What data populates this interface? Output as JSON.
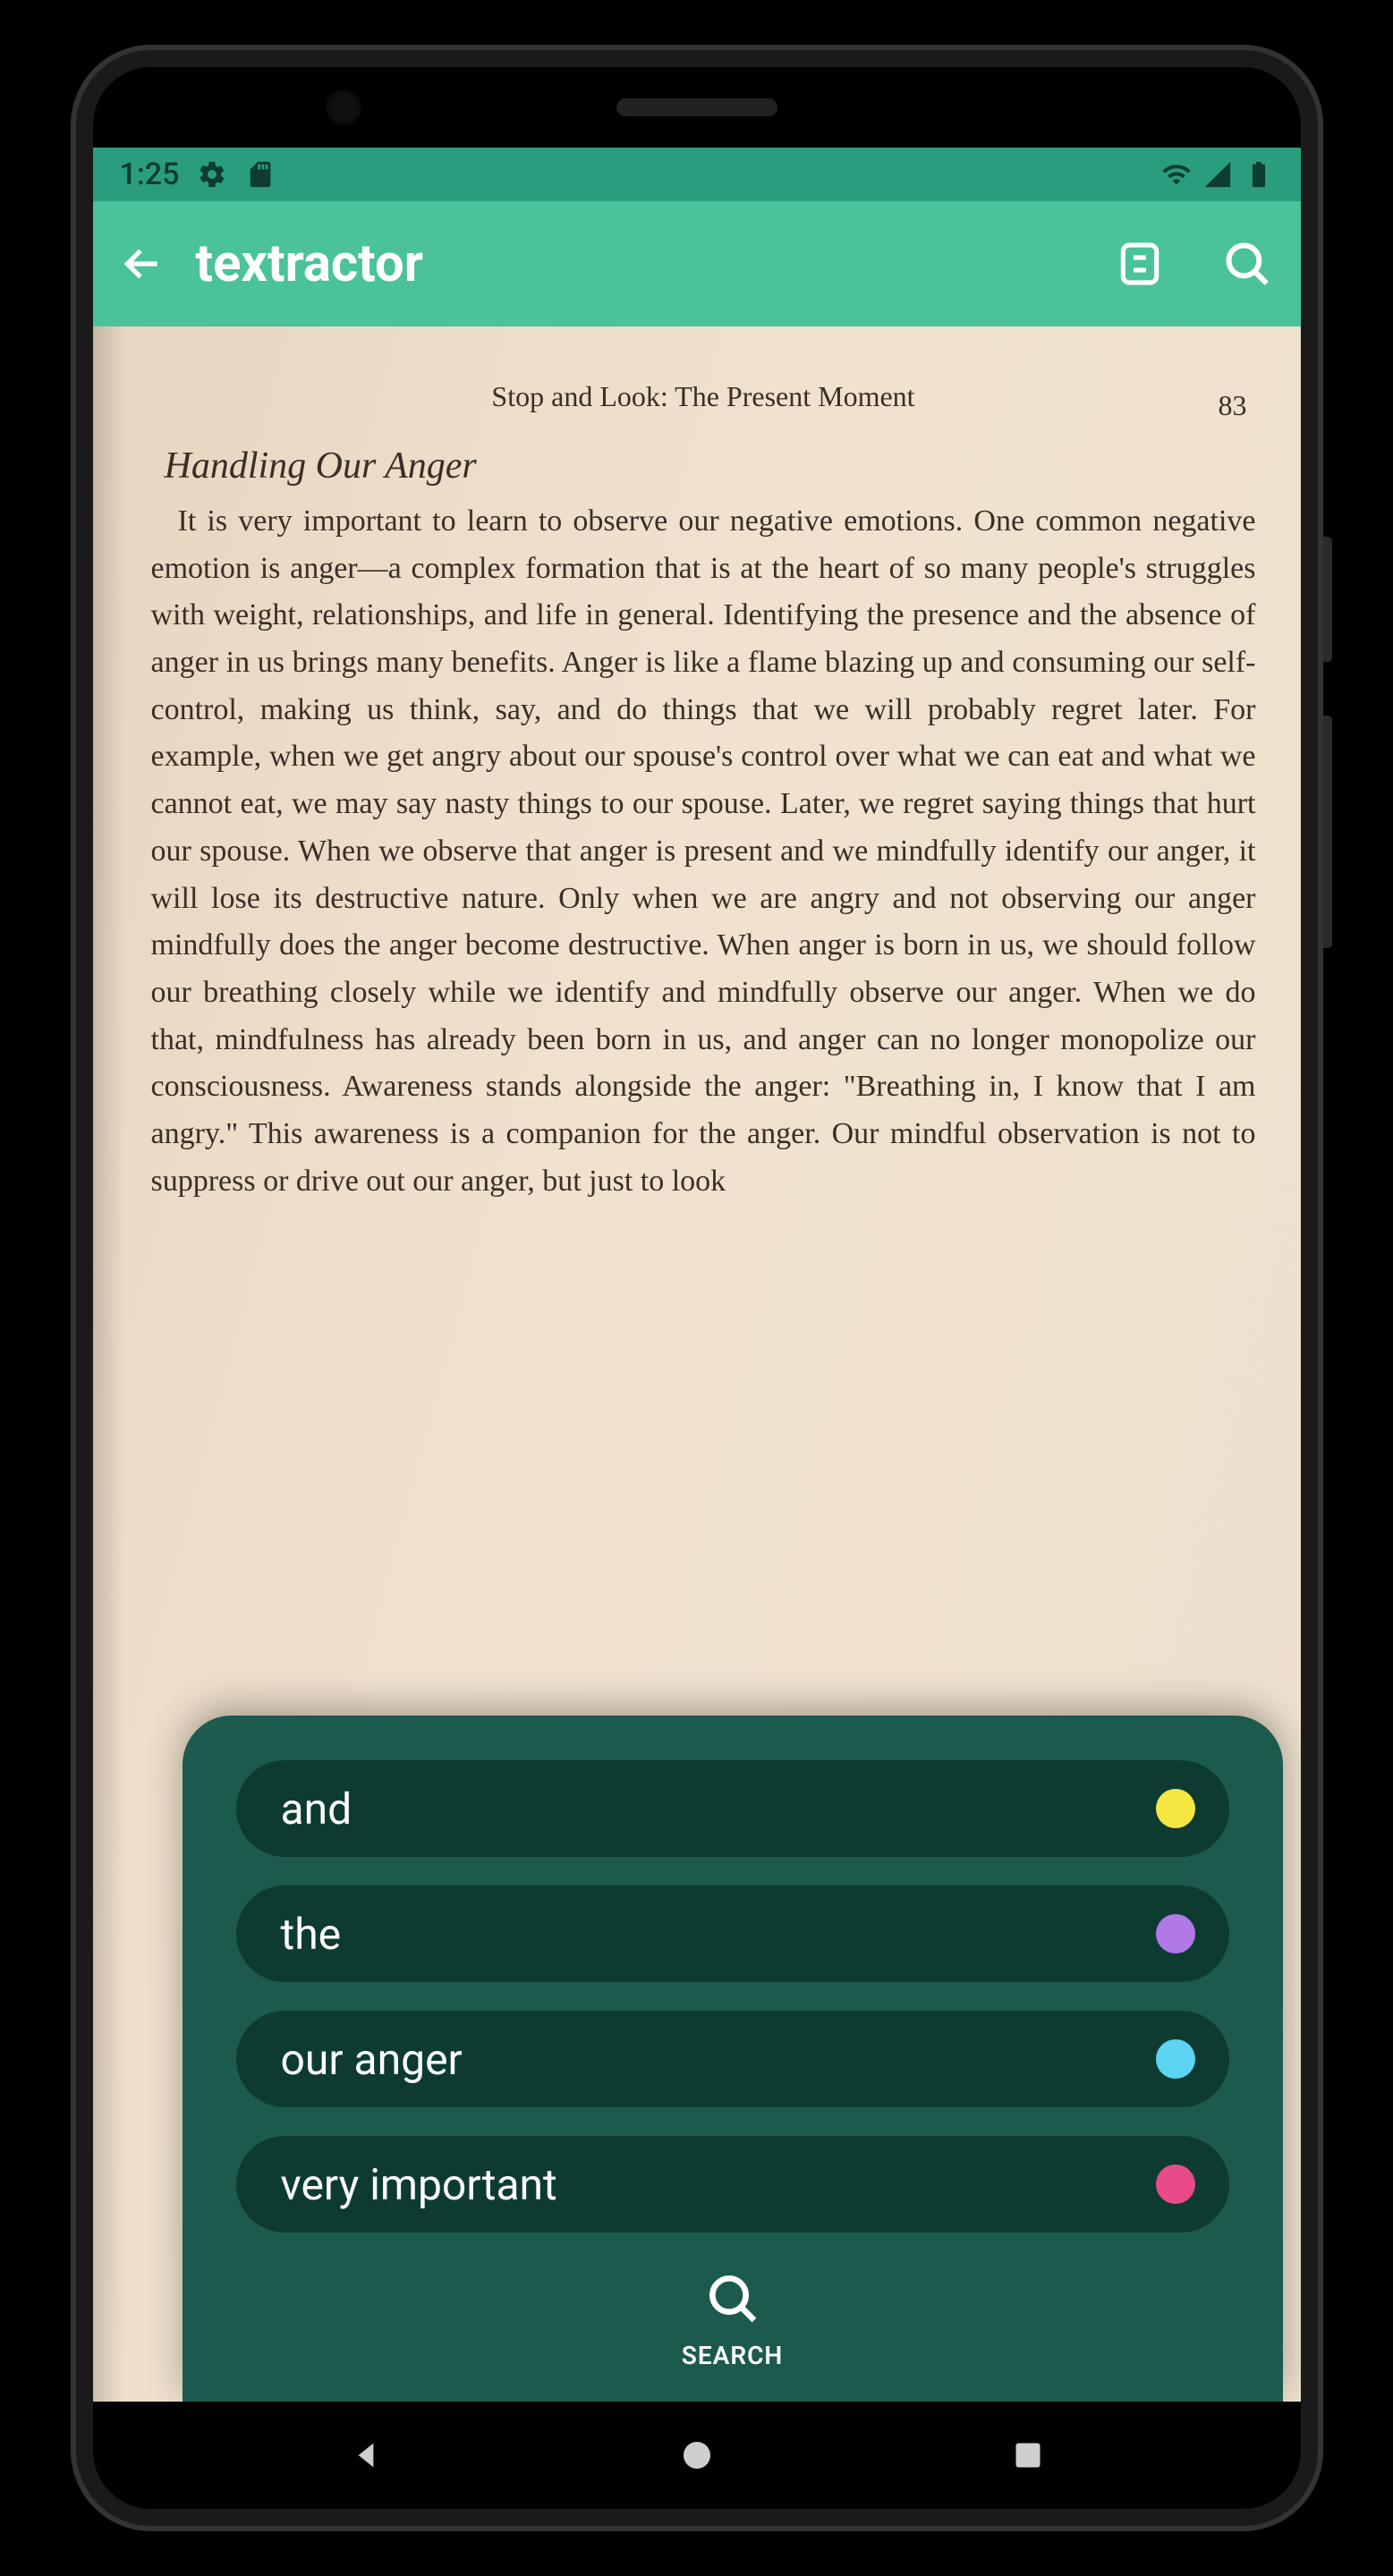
{
  "status": {
    "time": "1:25"
  },
  "app": {
    "title": "textractor"
  },
  "page": {
    "header": "Stop and Look: The Present Moment",
    "number": "83",
    "section_title": "Handling Our Anger",
    "body": "It is very important to learn to observe our negative emotions. One common negative emotion is anger—a complex formation that is at the heart of so many people's struggles with weight, relationships, and life in general. Identifying the presence and the absence of anger in us brings many benefits. Anger is like a flame blazing up and consuming our self-control, making us think, say, and do things that we will probably regret later. For example, when we get angry about our spouse's control over what we can eat and what we cannot eat, we may say nasty things to our spouse. Later, we regret saying things that hurt our spouse. When we observe that anger is present and we mindfully identify our anger, it will lose its destructive nature. Only when we are angry and not observing our anger mindfully does the anger become destructive. When anger is born in us, we should follow our breathing closely while we identify and mindfully observe our anger. When we do that, mindfulness has already been born in us, and anger can no longer monopolize our consciousness. Awareness stands alongside the anger: \"Breathing in, I know that I am angry.\" This awareness is a companion for the anger. Our mindful observation is not to suppress or drive out our anger, but just to look"
  },
  "search": {
    "items": [
      {
        "text": "and",
        "color": "#f5e642"
      },
      {
        "text": "the",
        "color": "#b178e8"
      },
      {
        "text": "our anger",
        "color": "#5ad4f0"
      },
      {
        "text": "very important",
        "color": "#e84a8a"
      }
    ],
    "action_label": "SEARCH"
  }
}
